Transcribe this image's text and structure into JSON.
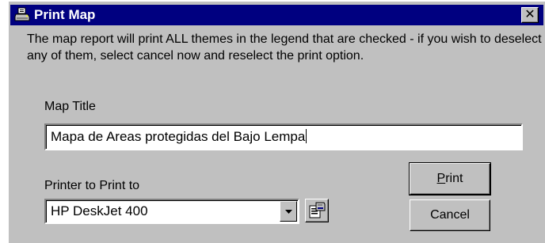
{
  "window": {
    "title": "Print Map",
    "close_glyph": "✕",
    "title_icon": "printer-icon"
  },
  "message": "The map report will print ALL themes in the legend that are checked - if you wish to deselect any of them, select cancel now and reselect the print option.",
  "map_title": {
    "label": "Map Title",
    "value": "Mapa de Areas protegidas del Bajo Lempa"
  },
  "printer": {
    "label": "Printer to Print to",
    "selected": "HP DeskJet 400",
    "properties_icon": "printer-properties-icon"
  },
  "buttons": {
    "print_mnemonic": "P",
    "print_rest": "rint",
    "cancel": "Cancel"
  },
  "colors": {
    "titlebar": "#000080",
    "dialog_face": "#c0c0c0"
  }
}
